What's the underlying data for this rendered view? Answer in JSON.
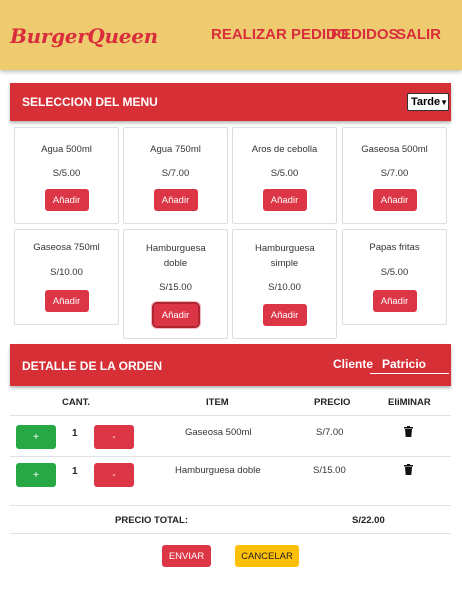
{
  "header": {
    "logo": "BurgerQueen",
    "nav": {
      "make_order": "REALIZAR PEDIDO",
      "orders": "PEDIDOS",
      "exit": "SALIR"
    }
  },
  "menu": {
    "title": "SELECCION DEL MENU",
    "shift_selected": "Tarde",
    "add_label": "Añadir",
    "items": [
      {
        "name": "Agua 500ml",
        "price": "S/5.00"
      },
      {
        "name": "Agua 750ml",
        "price": "S/7.00"
      },
      {
        "name": "Aros de cebolla",
        "price": "S/5.00"
      },
      {
        "name": "Gaseosa 500ml",
        "price": "S/7.00"
      },
      {
        "name": "Gaseosa 750ml",
        "price": "S/10.00"
      },
      {
        "name": "Hamburguesa doble",
        "price": "S/15.00"
      },
      {
        "name": "Hamburguesa simple",
        "price": "S/10.00"
      },
      {
        "name": "Papas fritas",
        "price": "S/5.00"
      }
    ]
  },
  "order": {
    "title": "DETALLE DE LA ORDEN",
    "client_label": "Cliente",
    "client_value": "Patricio",
    "columns": {
      "qty": "CANT.",
      "item": "ITEM",
      "price": "PRECIO",
      "delete": "EliMINAR"
    },
    "plus_label": "+",
    "minus_label": "-",
    "rows": [
      {
        "qty": "1",
        "item": "Gaseosa 500ml",
        "price": "S/7.00"
      },
      {
        "qty": "1",
        "item": "Hamburguesa doble",
        "price": "S/15.00"
      }
    ],
    "total_label": "PRECIO TOTAL:",
    "total_value": "S/22.00",
    "send_label": "ENVIAR",
    "cancel_label": "CANCELAR"
  },
  "colors": {
    "header_bg": "#eecb6f",
    "brand_red": "#d62f36",
    "success": "#28a745",
    "warning": "#ffc107"
  },
  "icons": {
    "delete": "trash-icon",
    "dropdown": "chevron-down-icon"
  }
}
